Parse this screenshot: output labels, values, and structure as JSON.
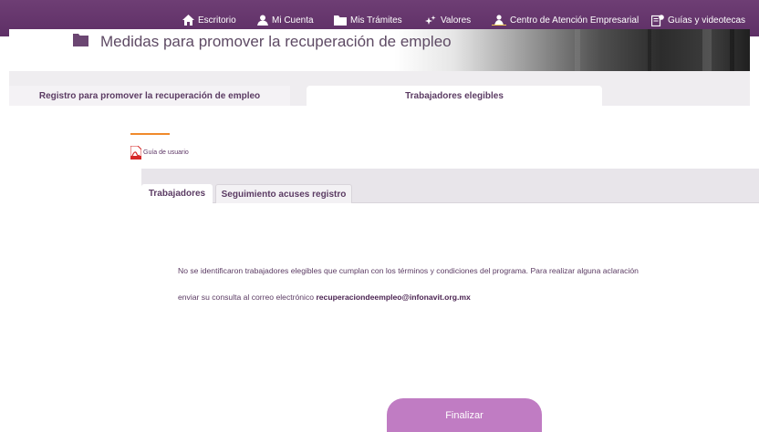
{
  "nav": {
    "items": [
      {
        "label": "Escritorio",
        "icon": "home-icon"
      },
      {
        "label": "Mi Cuenta",
        "icon": "user-icon"
      },
      {
        "label": "Mis Trámites",
        "icon": "folder-icon"
      },
      {
        "label": "Valores",
        "icon": "sparkle-icon"
      },
      {
        "label": "Centro de Atención Empresarial",
        "icon": "people-icon"
      },
      {
        "label": "Guías y videotecas",
        "icon": "guide-icon"
      }
    ]
  },
  "header": {
    "title": "Medidas para promover la recuperación de empleo"
  },
  "tabs": [
    {
      "label": "Registro para promover la recuperación de empleo",
      "active": false
    },
    {
      "label": "Trabajadores elegibles",
      "active": true
    }
  ],
  "guide_link": {
    "label": "Guía de usuario",
    "icon": "pdf-icon"
  },
  "subtabs": [
    {
      "label": "Trabajadores",
      "active": true
    },
    {
      "label": "Seguimiento acuses registro",
      "active": false
    }
  ],
  "message": {
    "line1": "No se identificaron trabajadores elegibles que cumplan con los términos y condiciones del programa. Para realizar alguna aclaración",
    "line2_prefix": "enviar su consulta al correo electrónico ",
    "email": "recuperaciondeempleo@infonavit.org.mx"
  },
  "finish_button": {
    "label": "Finalizar"
  },
  "colors": {
    "nav_bg": "#5e2f66",
    "accent_purple": "#5b3b63",
    "button": "#c07cc3",
    "orange": "#f08a2b"
  }
}
